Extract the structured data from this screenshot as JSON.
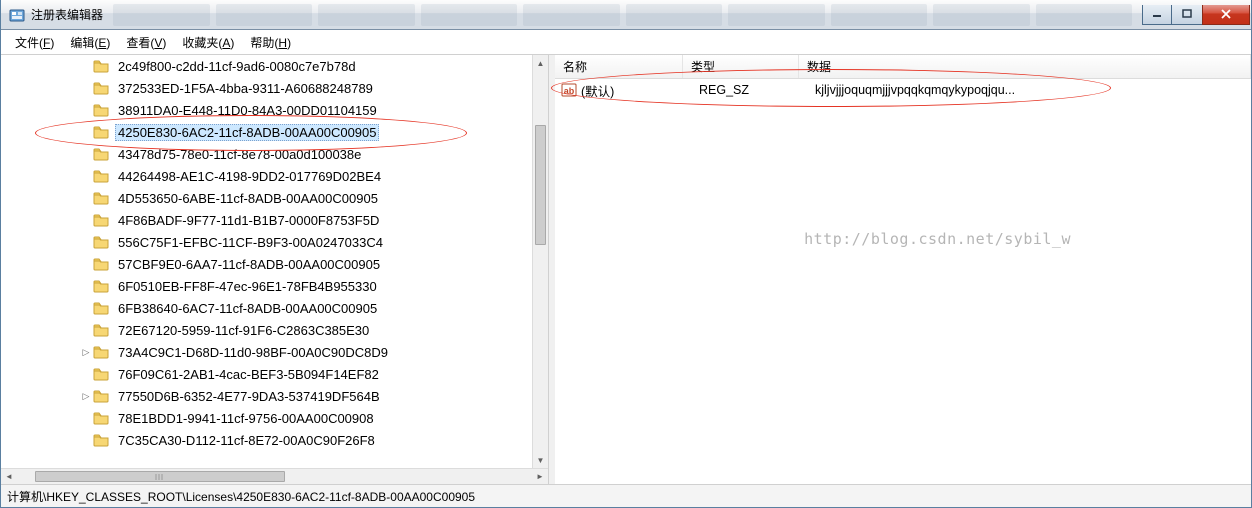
{
  "window": {
    "title": "注册表编辑器"
  },
  "menu": {
    "file": "文件(",
    "file_u": "F",
    "file_end": ")",
    "edit": "编辑(",
    "edit_u": "E",
    "edit_end": ")",
    "view": "查看(",
    "view_u": "V",
    "view_end": ")",
    "fav": "收藏夹(",
    "fav_u": "A",
    "fav_end": ")",
    "help": "帮助(",
    "help_u": "H",
    "help_end": ")"
  },
  "tree": {
    "items": [
      {
        "label": "2c49f800-c2dd-11cf-9ad6-0080c7e7b78d"
      },
      {
        "label": "372533ED-1F5A-4bba-9311-A60688248789"
      },
      {
        "label": "38911DA0-E448-11D0-84A3-00DD01104159"
      },
      {
        "label": "4250E830-6AC2-11cf-8ADB-00AA00C00905",
        "selected": true
      },
      {
        "label": "43478d75-78e0-11cf-8e78-00a0d100038e"
      },
      {
        "label": "44264498-AE1C-4198-9DD2-017769D02BE4"
      },
      {
        "label": "4D553650-6ABE-11cf-8ADB-00AA00C00905"
      },
      {
        "label": "4F86BADF-9F77-11d1-B1B7-0000F8753F5D"
      },
      {
        "label": "556C75F1-EFBC-11CF-B9F3-00A0247033C4"
      },
      {
        "label": "57CBF9E0-6AA7-11cf-8ADB-00AA00C00905"
      },
      {
        "label": "6F0510EB-FF8F-47ec-96E1-78FB4B955330"
      },
      {
        "label": "6FB38640-6AC7-11cf-8ADB-00AA00C00905"
      },
      {
        "label": "72E67120-5959-11cf-91F6-C2863C385E30"
      },
      {
        "label": "73A4C9C1-D68D-11d0-98BF-00A0C90DC8D9",
        "expandable": true
      },
      {
        "label": "76F09C61-2AB1-4cac-BEF3-5B094F14EF82"
      },
      {
        "label": "77550D6B-6352-4E77-9DA3-537419DF564B",
        "expandable": true
      },
      {
        "label": "78E1BDD1-9941-11cf-9756-00AA00C00908"
      },
      {
        "label": "7C35CA30-D112-11cf-8E72-00A0C90F26F8"
      }
    ]
  },
  "columns": {
    "name": "名称",
    "type": "类型",
    "data": "数据"
  },
  "values": [
    {
      "name": "(默认)",
      "type": "REG_SZ",
      "data": "kjljvjjjoquqmjjjvpqqkqmqykypoqjqu..."
    }
  ],
  "statusbar": "计算机\\HKEY_CLASSES_ROOT\\Licenses\\4250E830-6AC2-11cf-8ADB-00AA00C00905",
  "watermark": "http://blog.csdn.net/sybil_w"
}
